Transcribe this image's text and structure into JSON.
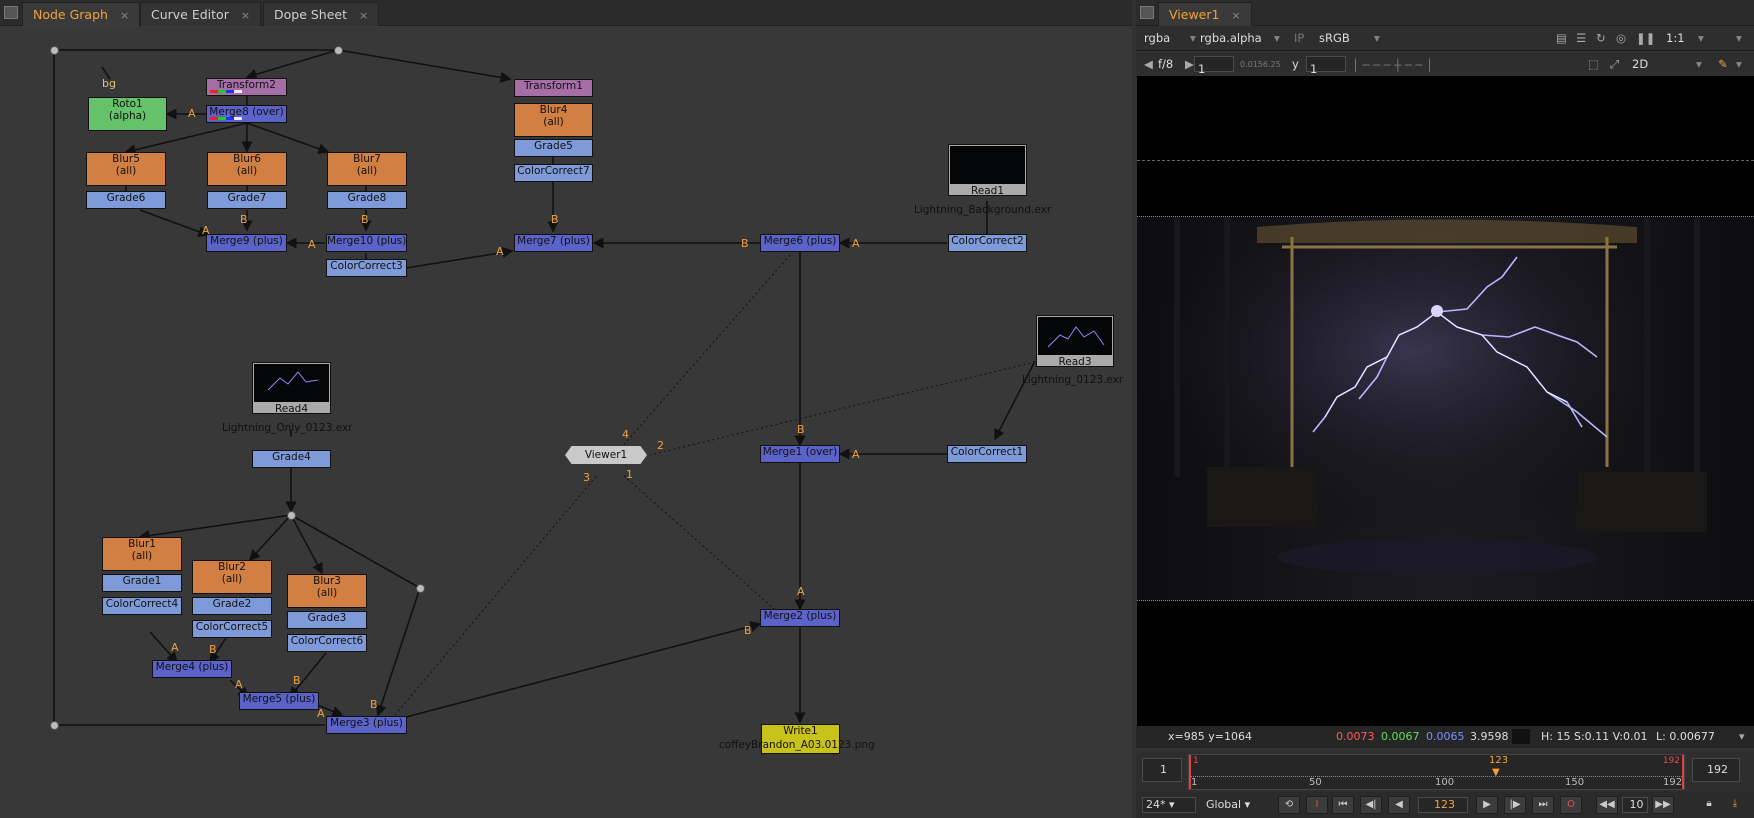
{
  "tabs_left": [
    {
      "label": "Node Graph"
    },
    {
      "label": "Curve Editor"
    },
    {
      "label": "Dope Sheet"
    }
  ],
  "tab_right": {
    "label": "Viewer1"
  },
  "close_glyph": "×",
  "nodes": {
    "bg": "bg",
    "roto1": [
      "Roto1",
      "(alpha)"
    ],
    "transform2": "Transform2",
    "merge8": "Merge8 (over)",
    "blur5": [
      "Blur5",
      "(all)"
    ],
    "blur6": [
      "Blur6",
      "(all)"
    ],
    "blur7": [
      "Blur7",
      "(all)"
    ],
    "grade6": "Grade6",
    "grade7": "Grade7",
    "grade8": "Grade8",
    "merge9": "Merge9 (plus)",
    "merge10": "Merge10 (plus)",
    "cc3": "ColorCorrect3",
    "transform1": "Transform1",
    "blur4": [
      "Blur4",
      "(all)"
    ],
    "grade5": "Grade5",
    "cc7": "ColorCorrect7",
    "merge7": "Merge7 (plus)",
    "merge6": "Merge6 (plus)",
    "read1": "Read1",
    "read1_file": "Lightning_Background.exr",
    "cc2": "ColorCorrect2",
    "read3": "Read3",
    "read3_file": "Lightning_0123.exr",
    "cc1": "ColorCorrect1",
    "read4": "Read4",
    "read4_file": "Lightning_Only_0123.exr",
    "grade4": "Grade4",
    "viewer1": "Viewer1",
    "merge1": "Merge1 (over)",
    "merge2": "Merge2 (plus)",
    "blur1": [
      "Blur1",
      "(all)"
    ],
    "blur2": [
      "Blur2",
      "(all)"
    ],
    "blur3": [
      "Blur3",
      "(all)"
    ],
    "grade1": "Grade1",
    "grade2": "Grade2",
    "grade3": "Grade3",
    "cc4": "ColorCorrect4",
    "cc5": "ColorCorrect5",
    "cc6": "ColorCorrect6",
    "merge4": "Merge4 (plus)",
    "merge5": "Merge5 (plus)",
    "merge3": "Merge3 (plus)",
    "write1": "Write1",
    "write1_file": "coffeyBrandon_A03.0123.png"
  },
  "input_tags": {
    "A": "A",
    "B": "B",
    "v1": "1",
    "v2": "2",
    "v3": "3",
    "v4": "4"
  },
  "viewer": {
    "channels": "rgba",
    "alpha": "rgba.alpha",
    "ip": "IP",
    "lut": "sRGB",
    "zoom": "1:1",
    "fstop": "f/8",
    "gain": "1",
    "gamma_label": "y",
    "gamma": "1",
    "mode": "2D",
    "slider_ticks": "0.0156.25"
  },
  "info": {
    "coords": "x=985 y=1064",
    "r": "0.0073",
    "g": "0.0067",
    "b": "0.0065",
    "a": "3.9598",
    "hsv": "H: 15 S:0.11 V:0.01",
    "lum": "L: 0.00677"
  },
  "timeline": {
    "start": "1",
    "end": "192",
    "current": "123",
    "ticks": [
      "1",
      "50",
      "100",
      "150",
      "192"
    ],
    "cur_top": "123",
    "end_top": "192",
    "start_top": "1"
  },
  "controls": {
    "fps": "24*",
    "scope": "Global",
    "frame": "123",
    "step": "10"
  },
  "colors": {
    "accent": "#f3a13a",
    "merge": "#5b63c9",
    "grade": "#7f9ad8",
    "blur": "#d27f44"
  }
}
